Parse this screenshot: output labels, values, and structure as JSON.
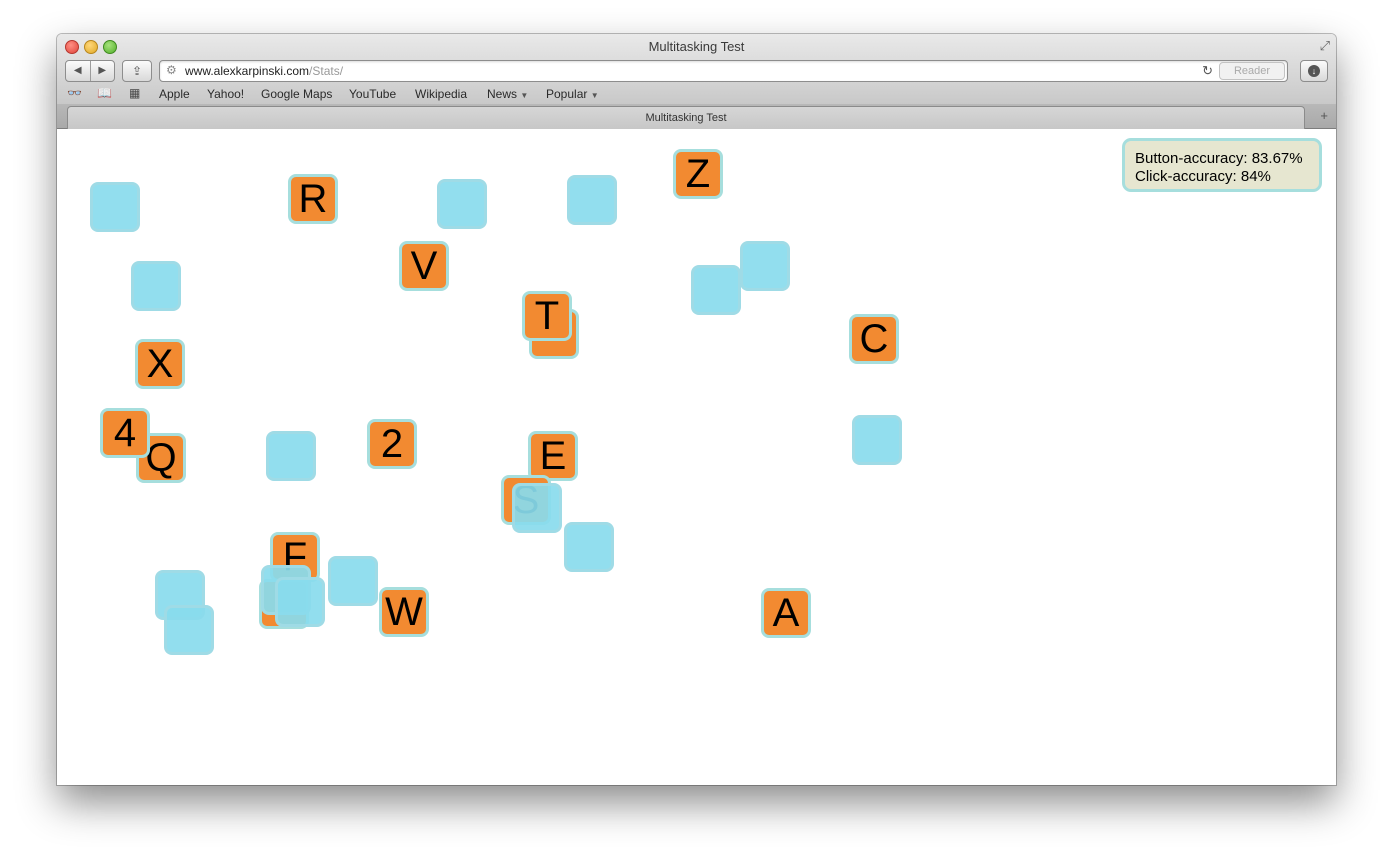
{
  "window": {
    "title": "Multitasking Test"
  },
  "toolbar": {
    "url_host": "www.alexkarpinski.com",
    "url_path": "/Stats/",
    "reader_label": "Reader"
  },
  "bookmarks": [
    {
      "label": "Apple"
    },
    {
      "label": "Yahoo!"
    },
    {
      "label": "Google Maps"
    },
    {
      "label": "YouTube"
    },
    {
      "label": "Wikipedia"
    },
    {
      "label": "News",
      "has_menu": true
    },
    {
      "label": "Popular",
      "has_menu": true
    }
  ],
  "tab": {
    "label": "Multitasking Test"
  },
  "stats": {
    "button_accuracy": "Button-accuracy: 83.67%",
    "click_accuracy": "Click-accuracy: 84%"
  },
  "tiles": {
    "z": "Z",
    "r": "R",
    "v": "V",
    "t": "T",
    "c": "C",
    "x": "X",
    "four": "4",
    "q": "Q",
    "two": "2",
    "e": "E",
    "s": "S",
    "f": "F",
    "w": "W",
    "a": "A"
  },
  "colors": {
    "orange_tile": "#f28a31",
    "blue_tile": "#89dbed",
    "tile_border": "#a6dedd",
    "stats_background": "#e6e6d0"
  }
}
